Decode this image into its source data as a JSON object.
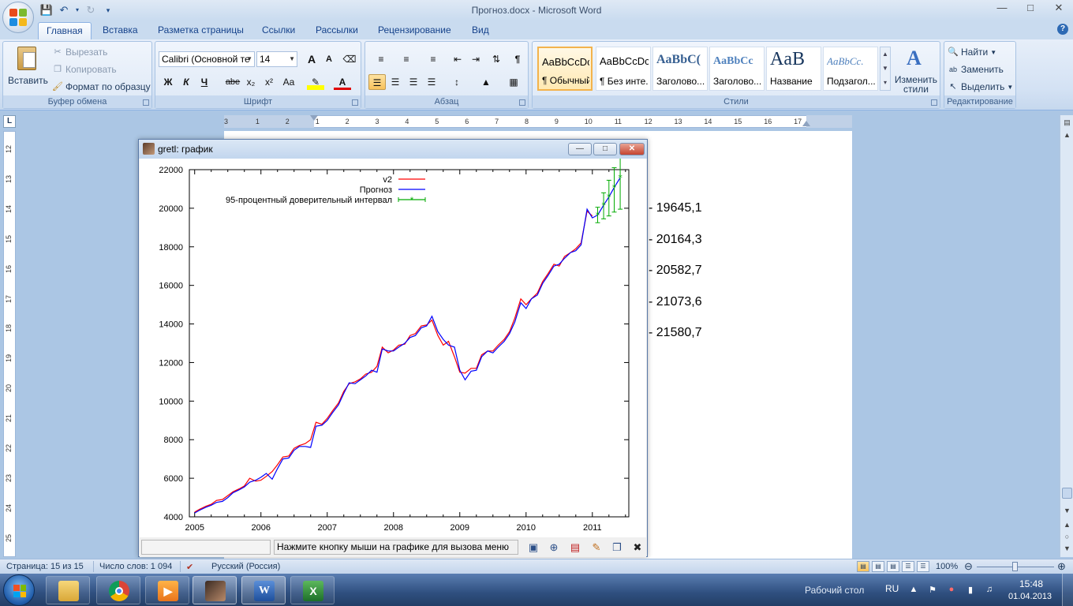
{
  "window": {
    "title": "Прогноз.docx - Microsoft Word",
    "min_icon": "minimize-icon",
    "max_icon": "maximize-icon",
    "close_icon": "close-icon"
  },
  "tabs": [
    "Главная",
    "Вставка",
    "Разметка страницы",
    "Ссылки",
    "Рассылки",
    "Рецензирование",
    "Вид"
  ],
  "ribbon": {
    "clipboard": {
      "label": "Буфер обмена",
      "paste": "Вставить",
      "cut": "Вырезать",
      "copy": "Копировать",
      "format_painter": "Формат по образцу"
    },
    "font": {
      "label": "Шрифт",
      "font_name": "Calibri (Основной те",
      "font_size": "14",
      "bold": "Ж",
      "italic": "К",
      "underline": "Ч",
      "strike": "abe",
      "subscript": "x₂",
      "superscript": "x²",
      "change_case": "Aa",
      "grow": "A",
      "shrink": "A"
    },
    "paragraph": {
      "label": "Абзац",
      "pilcrow": "¶"
    },
    "styles": {
      "label": "Стили",
      "items": [
        {
          "sample": "AaBbCcDc",
          "name": "¶ Обычный"
        },
        {
          "sample": "AaBbCcDc",
          "name": "¶ Без инте..."
        },
        {
          "sample": "AaBbC(",
          "name": "Заголово..."
        },
        {
          "sample": "AaBbCc",
          "name": "Заголово..."
        },
        {
          "sample": "AaB",
          "name": "Название"
        },
        {
          "sample": "AaBbCc.",
          "name": "Подзагол..."
        }
      ],
      "change_styles": "Изменить стили"
    },
    "editing": {
      "label": "Редактирование",
      "find": "Найти",
      "replace": "Заменить",
      "select": "Выделить"
    }
  },
  "ruler_h_numbers": [
    "3",
    "1",
    "2",
    "1",
    "2",
    "3",
    "4",
    "5",
    "6",
    "7",
    "8",
    "9",
    "10",
    "11",
    "12",
    "13",
    "14",
    "15",
    "16",
    "17"
  ],
  "ruler_v_numbers": [
    "12",
    "13",
    "14",
    "15",
    "16",
    "17",
    "18",
    "19",
    "20",
    "21",
    "22",
    "23",
    "24",
    "25"
  ],
  "document": {
    "lines": [
      "-  19645,1",
      "-  20164,3",
      "-  20582,7",
      "-  21073,6",
      "-  21580,7"
    ]
  },
  "gretl": {
    "title": "gretl: график",
    "status_message": "Нажмите кнопку мыши на графике для вызова меню"
  },
  "chart_data": {
    "type": "line",
    "title": "",
    "xlabel": "",
    "ylabel": "",
    "xlim": [
      2004.92,
      2011.55
    ],
    "ylim": [
      4000,
      22000
    ],
    "x_ticks": [
      "2005",
      "2006",
      "2007",
      "2008",
      "2009",
      "2010",
      "2011"
    ],
    "y_ticks": [
      "4000",
      "6000",
      "8000",
      "10000",
      "12000",
      "14000",
      "16000",
      "18000",
      "20000",
      "22000"
    ],
    "legend_position": "top-center",
    "series": [
      {
        "name": "v2",
        "color": "#ff0000",
        "x": [
          2005.0,
          2005.08,
          2005.17,
          2005.25,
          2005.33,
          2005.42,
          2005.5,
          2005.58,
          2005.67,
          2005.75,
          2005.83,
          2005.92,
          2006.0,
          2006.08,
          2006.17,
          2006.25,
          2006.33,
          2006.42,
          2006.5,
          2006.58,
          2006.67,
          2006.75,
          2006.83,
          2006.92,
          2007.0,
          2007.08,
          2007.17,
          2007.25,
          2007.33,
          2007.42,
          2007.5,
          2007.58,
          2007.67,
          2007.75,
          2007.83,
          2007.92,
          2008.0,
          2008.08,
          2008.17,
          2008.25,
          2008.33,
          2008.42,
          2008.5,
          2008.58,
          2008.67,
          2008.75,
          2008.83,
          2008.92,
          2009.0,
          2009.08,
          2009.17,
          2009.25,
          2009.33,
          2009.42,
          2009.5,
          2009.58,
          2009.67,
          2009.75,
          2009.83,
          2009.92,
          2010.0,
          2010.08,
          2010.17,
          2010.25,
          2010.33,
          2010.42,
          2010.5,
          2010.58,
          2010.67,
          2010.75,
          2010.83,
          2010.92,
          2011.0
        ],
        "y": [
          4250,
          4400,
          4550,
          4650,
          4850,
          4900,
          5100,
          5300,
          5450,
          5600,
          6000,
          5850,
          5900,
          6100,
          6350,
          6700,
          7100,
          7150,
          7550,
          7700,
          7800,
          8000,
          8900,
          8800,
          9100,
          9500,
          9900,
          10500,
          10900,
          11000,
          11150,
          11400,
          11500,
          11800,
          12800,
          12500,
          12650,
          12900,
          12950,
          13400,
          13500,
          13900,
          13950,
          14200,
          13400,
          12900,
          13100,
          12300,
          11500,
          11450,
          11700,
          11700,
          12400,
          12600,
          12600,
          12900,
          13200,
          13600,
          14300,
          15300,
          15000,
          15300,
          15600,
          16200,
          16600,
          17100,
          17000,
          17500,
          17700,
          17900,
          18200,
          19850,
          19600
        ]
      },
      {
        "name": "Прогноз",
        "color": "#0000ff",
        "x": [
          2005.0,
          2005.08,
          2005.17,
          2005.25,
          2005.33,
          2005.42,
          2005.5,
          2005.58,
          2005.67,
          2005.75,
          2005.83,
          2005.92,
          2006.0,
          2006.08,
          2006.17,
          2006.25,
          2006.33,
          2006.42,
          2006.5,
          2006.58,
          2006.67,
          2006.75,
          2006.83,
          2006.92,
          2007.0,
          2007.08,
          2007.17,
          2007.25,
          2007.33,
          2007.42,
          2007.5,
          2007.58,
          2007.67,
          2007.75,
          2007.83,
          2007.92,
          2008.0,
          2008.08,
          2008.17,
          2008.25,
          2008.33,
          2008.42,
          2008.5,
          2008.58,
          2008.67,
          2008.75,
          2008.83,
          2008.92,
          2009.0,
          2009.08,
          2009.17,
          2009.25,
          2009.33,
          2009.42,
          2009.5,
          2009.58,
          2009.67,
          2009.75,
          2009.83,
          2009.92,
          2010.0,
          2010.08,
          2010.17,
          2010.25,
          2010.33,
          2010.42,
          2010.5,
          2010.58,
          2010.67,
          2010.75,
          2010.83,
          2010.92,
          2011.0,
          2011.08,
          2011.17,
          2011.25,
          2011.33,
          2011.42
        ],
        "y": [
          4200,
          4350,
          4500,
          4600,
          4750,
          4800,
          5000,
          5250,
          5400,
          5550,
          5800,
          5900,
          6050,
          6250,
          5950,
          6500,
          7000,
          7050,
          7450,
          7650,
          7650,
          7600,
          8700,
          8750,
          9000,
          9400,
          9800,
          10400,
          10950,
          10900,
          11100,
          11300,
          11600,
          11500,
          12700,
          12600,
          12600,
          12800,
          13000,
          13300,
          13400,
          13800,
          13900,
          14400,
          13600,
          13200,
          12900,
          12800,
          11600,
          11100,
          11550,
          11600,
          12300,
          12600,
          12500,
          12800,
          13100,
          13500,
          14100,
          15100,
          14800,
          15300,
          15500,
          16100,
          16500,
          17000,
          17100,
          17400,
          17700,
          17800,
          18100,
          19950,
          19500,
          19645.1,
          20164.3,
          20582.7,
          21073.6,
          21580.7
        ]
      },
      {
        "name": "95-процентный доверительный интервал",
        "color": "#00aa00",
        "x": [
          2011.08,
          2011.17,
          2011.25,
          2011.33,
          2011.42
        ],
        "y": [
          19645.1,
          20164.3,
          20582.7,
          21073.6,
          21580.7
        ],
        "low": [
          19250,
          19450,
          19600,
          19800,
          19950
        ],
        "high": [
          20050,
          20800,
          21450,
          22100,
          22650
        ]
      }
    ]
  },
  "statusbar": {
    "page": "Страница: 15 из 15",
    "words": "Число слов: 1 094",
    "language": "Русский (Россия)",
    "zoom": "100%"
  },
  "taskbar": {
    "desktop_label": "Рабочий стол",
    "lang": "RU",
    "time": "15:48",
    "date": "01.04.2013"
  }
}
